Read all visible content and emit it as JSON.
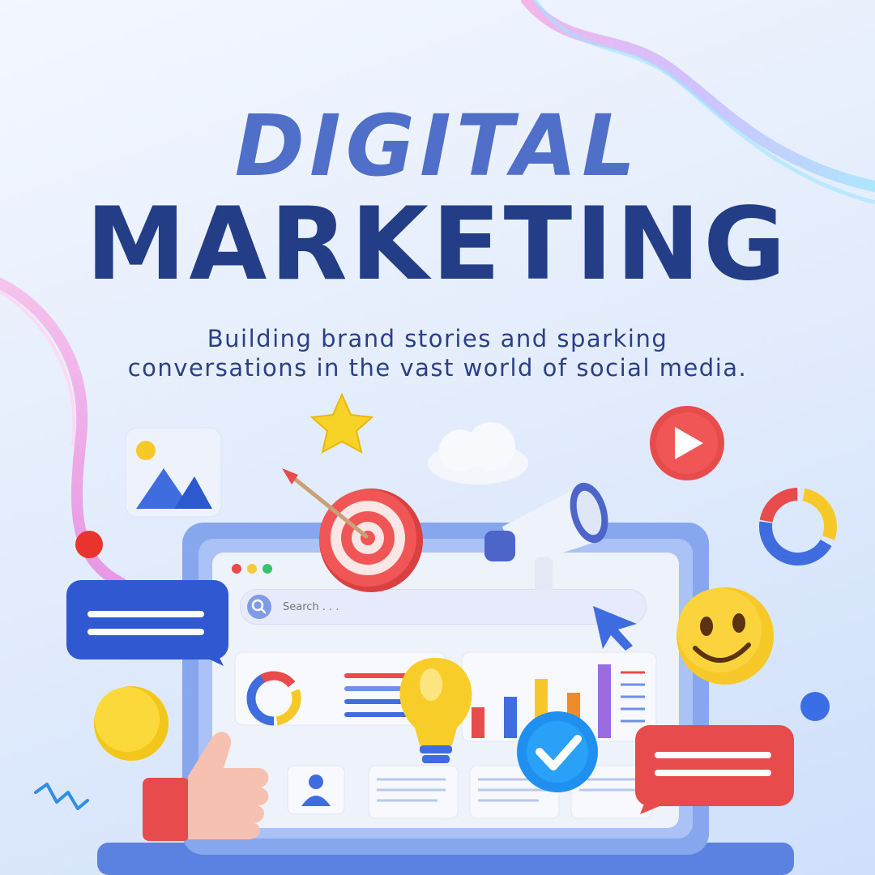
{
  "heading": {
    "line1": "DIGITAL",
    "line2": "MARKETING"
  },
  "subtitle": {
    "line1": "Building brand stories and sparking",
    "line2": "conversations in the vast world of social media."
  },
  "search": {
    "placeholder": "Search . . ."
  },
  "colors": {
    "title_light": "#4f6fc9",
    "title_dark": "#233d86",
    "laptop_frame": "#7a9fe8",
    "accent_red": "#e84b4b",
    "accent_yellow": "#f7d227",
    "accent_blue": "#3f6de0"
  }
}
